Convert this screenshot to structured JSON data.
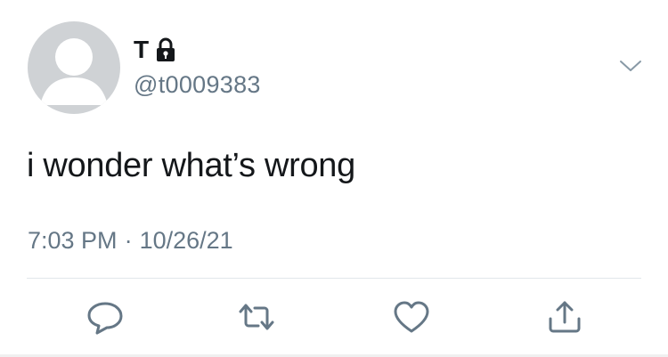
{
  "tweet": {
    "display_name": "T",
    "handle": "@t0009383",
    "text": "i wonder what’s wrong",
    "time": "7:03 PM",
    "separator": "·",
    "date": "10/26/21"
  },
  "icons": {
    "avatar": "default-avatar-icon",
    "lock": "lock-icon",
    "more": "chevron-down-icon",
    "reply": "reply-icon",
    "retweet": "retweet-icon",
    "like": "heart-icon",
    "share": "share-icon"
  },
  "colors": {
    "text": "#14171a",
    "secondary": "#657786",
    "avatar_bg": "#cfd2d5",
    "divider": "#e1e6ea"
  }
}
